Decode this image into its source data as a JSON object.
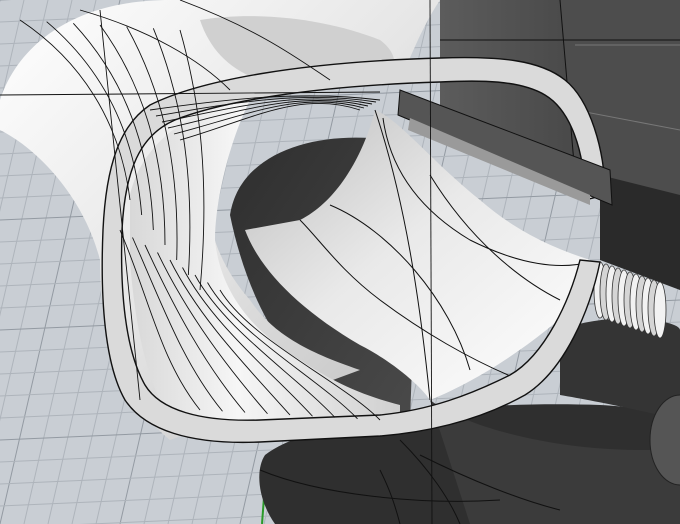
{
  "viewport": {
    "background": "#c9ced4",
    "grid_minor_color": "#aeb4bb",
    "grid_major_color": "#939aa2",
    "world_axis_y_color": "#2a9a2a",
    "surface_light": "#f4f4f4",
    "surface_mid": "#b9b9b9",
    "surface_dark": "#3c3c3c",
    "edge_color": "#111111",
    "objects": [
      {
        "name": "swept-tube-surface"
      },
      {
        "name": "rounded-rectangle-profile"
      },
      {
        "name": "half-pipe-surface"
      },
      {
        "name": "dark-base-solid"
      },
      {
        "name": "right-box-solid"
      },
      {
        "name": "threaded-rod"
      }
    ]
  }
}
